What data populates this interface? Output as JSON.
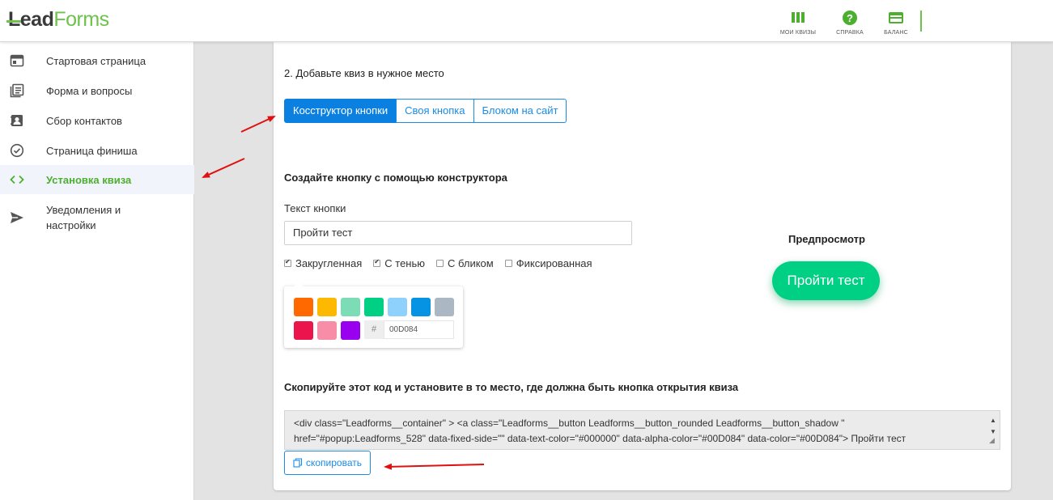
{
  "header": {
    "logo_lead": "Lead",
    "logo_forms": "Forms",
    "nav": [
      {
        "label": "МОИ КВИЗЫ",
        "icon": "grid-icon"
      },
      {
        "label": "СПРАВКА",
        "icon": "help-icon"
      },
      {
        "label": "БАЛАНС",
        "icon": "wallet-icon"
      }
    ]
  },
  "sidebar": {
    "items": [
      {
        "label": "Стартовая страница",
        "icon": "window-icon"
      },
      {
        "label": "Форма и вопросы",
        "icon": "list-icon"
      },
      {
        "label": "Сбор контактов",
        "icon": "contact-icon"
      },
      {
        "label": "Страница финиша",
        "icon": "check-circle-icon"
      },
      {
        "label": "Установка квиза",
        "icon": "code-icon",
        "active": true
      },
      {
        "label_line1": "Уведомления и",
        "label_line2": "настройки",
        "icon": "send-icon"
      }
    ]
  },
  "main": {
    "step_title": "2. Добавьте квиз в нужное место",
    "tabs": [
      "Косструктор кнопки",
      "Своя кнопка",
      "Блоком на сайт"
    ],
    "constructor_title": "Создайте кнопку с помощью конструктора",
    "button_text_label": "Текст кнопки",
    "button_text_value": "Пройти тест",
    "options": [
      {
        "label": "Закругленная",
        "checked": true
      },
      {
        "label": "С тенью",
        "checked": true
      },
      {
        "label": "С бликом",
        "checked": false
      },
      {
        "label": "Фиксированная",
        "checked": false
      }
    ],
    "palette": {
      "colors": [
        "#FF6900",
        "#FCB900",
        "#7BDCB5",
        "#00D084",
        "#8ED1FC",
        "#0693E3",
        "#ABB8C3",
        "#EB144C",
        "#F78DA7",
        "#9900EF"
      ],
      "hash": "#",
      "hex_value": "00D084"
    },
    "preview_title": "Предпросмотр",
    "preview_button": "Пройти тест",
    "preview_color": "#00D084",
    "code_title": "Скопируйте этот код и установите в то место, где должна быть кнопка открытия квиза",
    "code_line1": "<div class=\"Leadforms__container\" > <a class=\"Leadforms__button Leadforms__button_rounded Leadforms__button_shadow \"",
    "code_line2": "href=\"#popup:Leadforms_528\" data-fixed-side=\"\" data-text-color=\"#000000\" data-alpha-color=\"#00D084\" data-color=\"#00D084\"> Пройти тест",
    "copy_label": "скопировать"
  },
  "colors": {
    "accent_green": "#6CC24A",
    "primary_blue": "#0C80E0",
    "annotation_red": "#E01010"
  }
}
